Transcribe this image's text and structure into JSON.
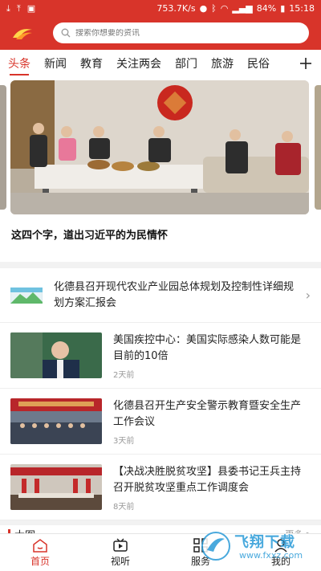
{
  "status": {
    "speed": "753.7K/s",
    "battery": "84%",
    "time": "15:18"
  },
  "search": {
    "placeholder": "搜索你想要的资讯"
  },
  "tabs": [
    "头条",
    "新闻",
    "教育",
    "关注两会",
    "部门",
    "旅游",
    "民俗"
  ],
  "banner": {
    "title": "这四个字，道出习近平的为民情怀"
  },
  "feed": {
    "text_item": {
      "title": "化德县召开现代农业产业园总体规划及控制性详细规划方案汇报会"
    },
    "items": [
      {
        "title": "美国疾控中心：美国实际感染人数可能是目前的10倍",
        "time": "2天前"
      },
      {
        "title": "化德县召开生产安全警示教育暨安全生产工作会议",
        "time": "3天前"
      },
      {
        "title": "【决战决胜脱贫攻坚】县委书记王兵主持召开脱贫攻坚重点工作调度会",
        "time": "8天前"
      }
    ]
  },
  "section": {
    "title": "大图",
    "more": "更多 >"
  },
  "nav": {
    "home": "首页",
    "video": "视听",
    "service": "服务",
    "mine": "我的"
  },
  "watermark": {
    "text": "飞翔下载",
    "sub": "www.fxxz.com"
  },
  "colors": {
    "brand": "#d8342a",
    "bg": "#f2f2f2"
  }
}
